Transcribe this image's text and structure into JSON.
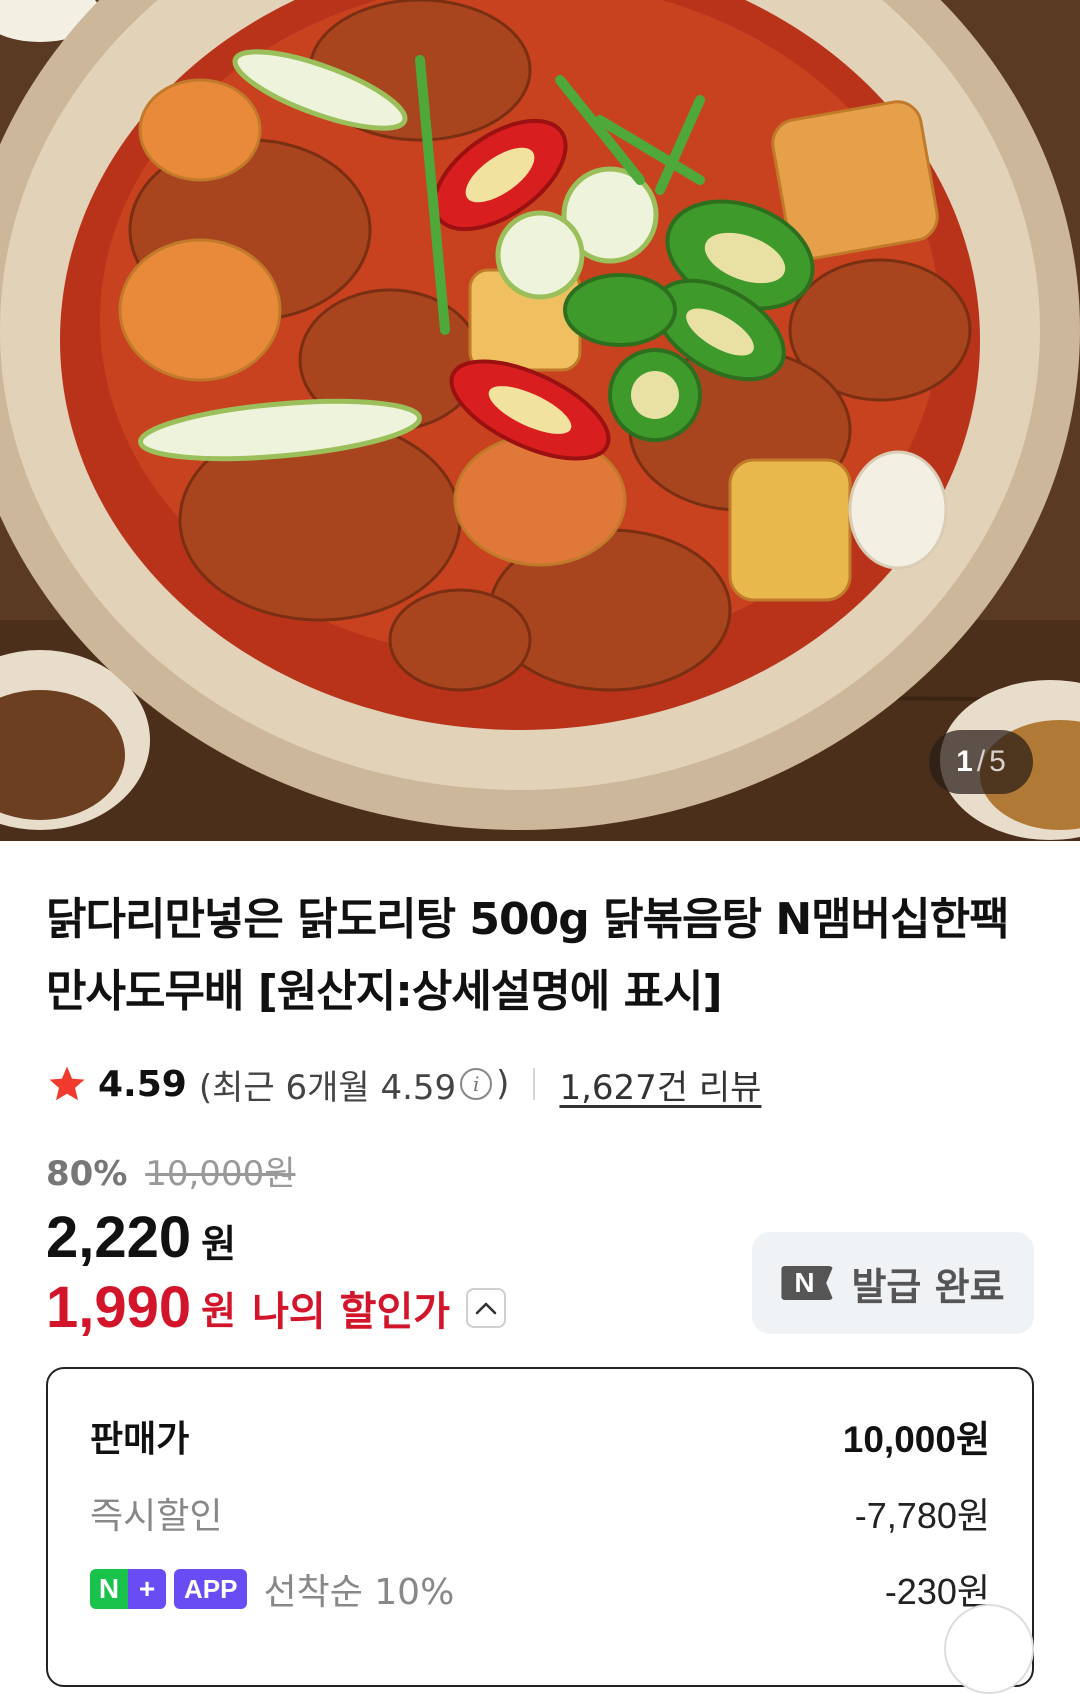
{
  "gallery": {
    "current": "1",
    "separator": "/",
    "total": "5"
  },
  "product": {
    "title_line1": "닭다리만넣은 닭도리탕 500g 닭볶음탕 N맴버십한팩",
    "title_line2": "만사도무배 [원산지:상세설명에 표시]"
  },
  "rating": {
    "score": "4.59",
    "recent_prefix": "(최근 6개월 4.59",
    "recent_suffix": ")",
    "reviews": "1,627건 리뷰"
  },
  "pricing": {
    "discount_rate": "80%",
    "original_price": "10,000원",
    "sale_price": "2,220",
    "sale_unit": "원",
    "my_price": "1,990",
    "my_unit": "원",
    "my_label": "나의 할인가",
    "coupon_badge": "N",
    "coupon_label": "발급 완료"
  },
  "breakdown": {
    "rows": [
      {
        "label": "판매가",
        "value": "10,000원"
      },
      {
        "label": "즉시할인",
        "value": "-7,780원"
      },
      {
        "label": "선착순 10%",
        "value": "-230원",
        "badge_n": "N",
        "badge_plus": "+",
        "badge_app": "APP"
      }
    ]
  },
  "colors": {
    "accent_red": "#d3152b",
    "star": "#f03a2e",
    "npay_green": "#19c24b",
    "membership_purple": "#6a4cf5"
  }
}
